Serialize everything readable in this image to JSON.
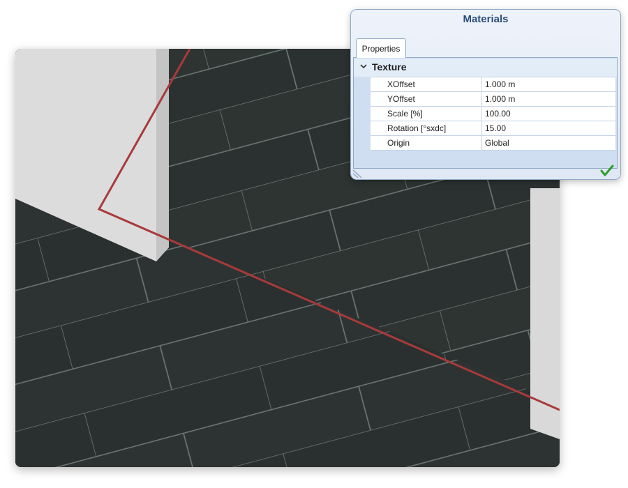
{
  "panel": {
    "title": "Materials",
    "tab_label": "Properties",
    "group": {
      "label": "Texture",
      "expanded_icon": "chevron-down-icon"
    },
    "properties": [
      {
        "name": "XOffset",
        "value": "1.000 m"
      },
      {
        "name": "YOffset",
        "value": "1.000 m"
      },
      {
        "name": "Scale  [%]",
        "value": "100.00"
      },
      {
        "name": "Rotation  [°sxdc]",
        "value": "15.00"
      },
      {
        "name": "Origin",
        "value": "Global"
      }
    ],
    "icons": {
      "resize": "resize-grip-icon",
      "confirm": "checkmark-icon"
    }
  },
  "viewport": {
    "texture_rotation_deg": 15,
    "colors": {
      "floor": "#2a302f",
      "grout": "#6e7a78",
      "wall": "#dcdcdc",
      "wall_edge": "#c2c2c2",
      "selection": "#a93a3a",
      "confirm": "#2e9d2e",
      "panel_title": "#2b4f7c"
    }
  }
}
